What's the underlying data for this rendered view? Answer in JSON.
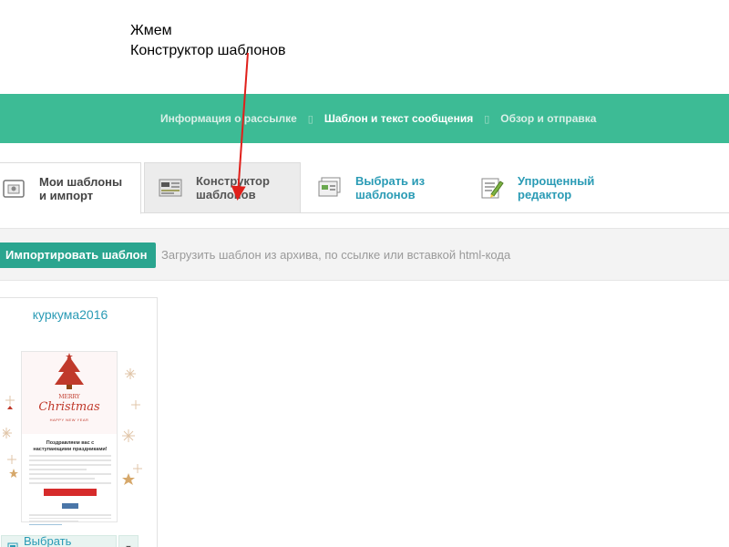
{
  "annotation": {
    "line1": "Жмем",
    "line2": "Конструктор шаблонов"
  },
  "steps": [
    {
      "label": "Информация о рассылке",
      "active": false
    },
    {
      "label": "Шаблон и текст сообщения",
      "active": true
    },
    {
      "label": "Обзор и отправка",
      "active": false
    }
  ],
  "tabs": {
    "mine": {
      "line1": "Мои шаблоны",
      "line2": "и импорт"
    },
    "constructor": {
      "line1": "Конструктор",
      "line2": "шаблонов"
    },
    "choose": {
      "line1": "Выбрать из",
      "line2": "шаблонов"
    },
    "simple": {
      "line1": "Упрощенный",
      "line2": "редактор"
    }
  },
  "import": {
    "button": "Импортировать шаблон",
    "hint": "Загрузить шаблон из архива, по ссылке или вставкой html-кода"
  },
  "card": {
    "title": "куркума2016",
    "preview": {
      "merry": "MERRY",
      "christmas": "Christmas",
      "newyear": "HAPPY NEW YEAR",
      "greeting": "Поздравляем вас с наступающими праздниками!"
    },
    "choose_button": "Выбрать шаблон"
  },
  "colors": {
    "stepbar": "#3dbb95",
    "accent": "#2aa58f",
    "link": "#2a9bb5",
    "arrow": "#e0201b"
  },
  "icons": {
    "step_separator": "chevron-separator-icon",
    "mine": "import-box-icon",
    "constructor": "layout-builder-icon",
    "choose": "template-gallery-icon",
    "simple": "pencil-editor-icon",
    "choose_button": "template-icon",
    "dropdown": "caret-down-icon"
  }
}
